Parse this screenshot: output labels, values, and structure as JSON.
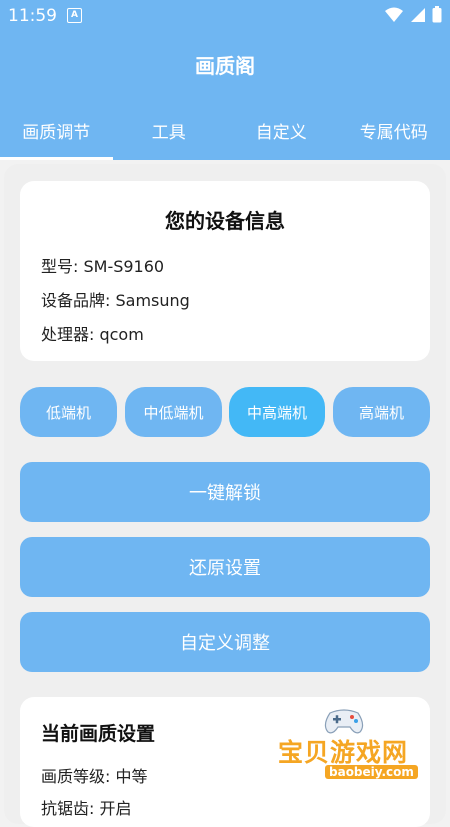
{
  "status": {
    "time": "11:59",
    "notification_glyph": "A"
  },
  "app": {
    "title": "画质阁"
  },
  "tabs": [
    {
      "label": "画质调节",
      "active": true
    },
    {
      "label": "工具",
      "active": false
    },
    {
      "label": "自定义",
      "active": false
    },
    {
      "label": "专属代码",
      "active": false
    }
  ],
  "device": {
    "heading": "您的设备信息",
    "model": "型号: SM-S9160",
    "brand": "设备品牌: Samsung",
    "processor": "处理器: qcom"
  },
  "tiers": [
    {
      "label": "低端机",
      "selected": false
    },
    {
      "label": "中低端机",
      "selected": false
    },
    {
      "label": "中高端机",
      "selected": true
    },
    {
      "label": "高端机",
      "selected": false
    }
  ],
  "actions": {
    "unlock": "一键解锁",
    "restore": "还原设置",
    "custom": "自定义调整"
  },
  "current": {
    "heading": "当前画质设置",
    "quality": "画质等级: 中等",
    "extra": "抗锯齿: 开启"
  },
  "watermark": {
    "title": "宝贝游戏网",
    "url": "baobeiy.com"
  },
  "colors": {
    "primary": "#6fb6f2",
    "selected": "#43b8f6",
    "watermark": "#f5a623"
  }
}
